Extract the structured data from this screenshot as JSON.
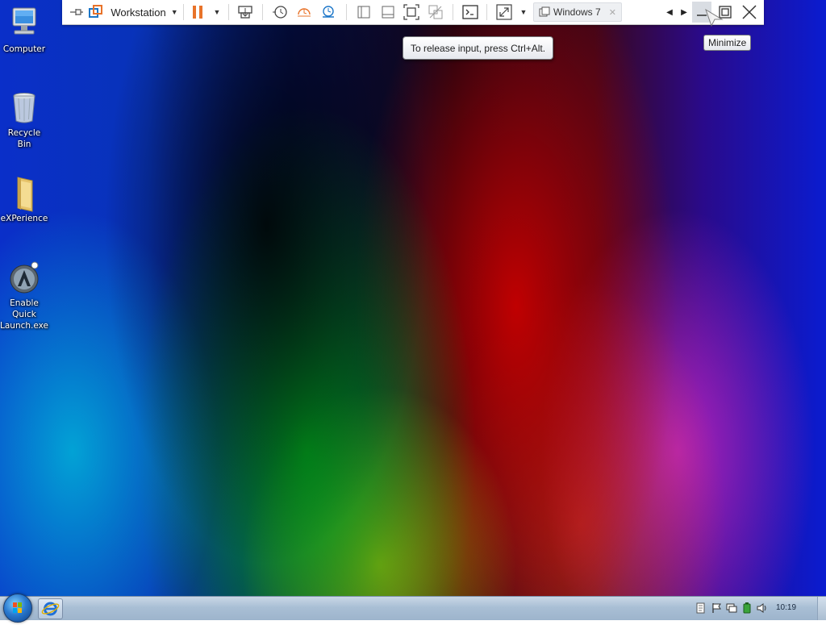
{
  "desktop": {
    "icons": [
      {
        "label": "Computer"
      },
      {
        "label": "Recycle Bin"
      },
      {
        "label": "eXPerience"
      },
      {
        "label": "Enable Quick Launch.exe"
      }
    ]
  },
  "vmware_toolbar": {
    "menu_label": "Workstation",
    "vm_tab_label": "Windows 7",
    "icons": [
      "pin-icon",
      "vmware-logo-icon",
      "pause-icon",
      "send-keys-icon",
      "snapshot-icon",
      "revert-snapshot-icon",
      "snapshot-manager-icon",
      "console-view-icon",
      "thumbnail-view-icon",
      "full-screen-icon",
      "unity-icon",
      "terminal-icon",
      "stretch-icon",
      "minimize-icon",
      "restore-icon",
      "close-icon"
    ]
  },
  "tooltips": {
    "release_input": "To release input, press Ctrl+Alt.",
    "minimize": "Minimize"
  },
  "taskbar": {
    "clock": "10:19",
    "tray_icons": [
      "action-center-icon",
      "flag-icon",
      "network-icon",
      "battery-icon",
      "volume-icon"
    ]
  },
  "colors": {
    "toolbar_accent": "#e8732a",
    "vmware_blue": "#1c76c8",
    "taskbar": "#b0c4d8"
  }
}
